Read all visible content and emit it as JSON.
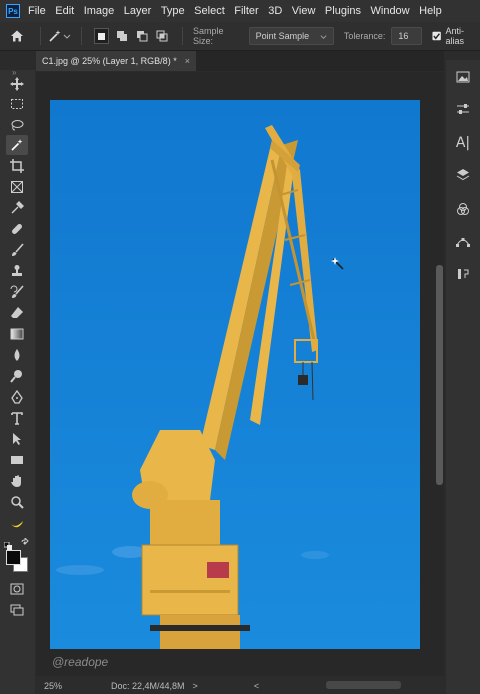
{
  "app": {
    "logo": "Ps"
  },
  "menu": [
    "File",
    "Edit",
    "Image",
    "Layer",
    "Type",
    "Select",
    "Filter",
    "3D",
    "View",
    "Plugins",
    "Window",
    "Help"
  ],
  "options": {
    "sample_size_label": "Sample Size:",
    "sample_size_value": "Point Sample",
    "tolerance_label": "Tolerance:",
    "tolerance_value": "16",
    "antialias_label": "Anti-alias",
    "antialias_checked": true
  },
  "document": {
    "tab_title": "C1.jpg @ 25% (Layer 1, RGB/8) *",
    "close_glyph": "×",
    "watermark": "@readope"
  },
  "status": {
    "zoom": "25%",
    "doc_info": "Doc: 22,4M/44,8M",
    "arrow": ">",
    "left_arrow": "<"
  },
  "right_panel": {
    "char_glyph": "A|"
  },
  "tool_icons": [
    "move-icon",
    "marquee-icon",
    "lasso-icon",
    "magic-wand-icon",
    "crop-icon",
    "frame-icon",
    "eyedropper-icon",
    "healing-icon",
    "brush-icon",
    "stamp-icon",
    "history-brush-icon",
    "eraser-icon",
    "gradient-icon",
    "blur-icon",
    "dodge-icon",
    "pen-icon",
    "type-icon",
    "path-select-icon",
    "rectangle-icon",
    "hand-icon",
    "zoom-icon",
    "banana-icon"
  ],
  "colors": {
    "canvas_sky": "#1682d4",
    "crane": "#e9b64a",
    "crane_shade": "#c99a33"
  }
}
